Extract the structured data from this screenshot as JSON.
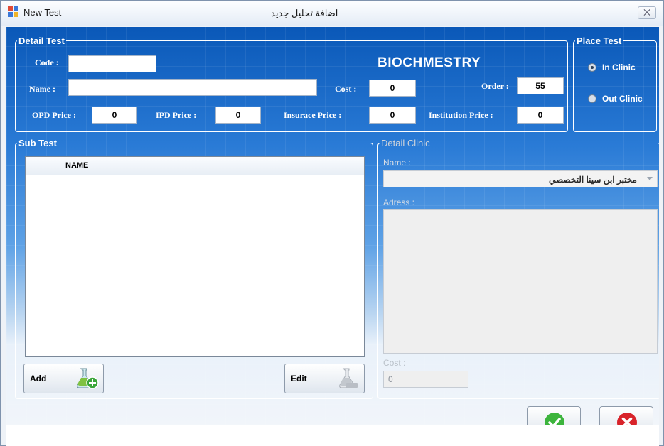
{
  "window": {
    "title": "New Test",
    "title_arabic": "اضافة تحليل جديد",
    "close_glyph": "⨉"
  },
  "detail_test": {
    "legend": "Detail Test",
    "code_label": "Code :",
    "code_value": "",
    "name_label": "Name :",
    "name_value": "",
    "department": "BIOCHMESTRY",
    "cost_label": "Cost :",
    "cost_value": "0",
    "order_label": "Order :",
    "order_value": "55",
    "opd_label": "OPD Price :",
    "opd_value": "0",
    "ipd_label": "IPD Price :",
    "ipd_value": "0",
    "insurance_label": "Insurace Price :",
    "insurance_value": "0",
    "institution_label": "Institution Price :",
    "institution_value": "0"
  },
  "place_test": {
    "legend": "Place Test",
    "options": [
      "In Clinic",
      "Out Clinic"
    ],
    "selected": "In Clinic"
  },
  "sub_test": {
    "legend": "Sub Test",
    "columns": [
      "NAME"
    ],
    "rows": [],
    "add_label": "Add",
    "edit_label": "Edit"
  },
  "detail_clinic": {
    "legend": "Detail Clinic",
    "name_label": "Name :",
    "name_value": "مختبر ابن سينا التخصصي",
    "address_label": "Adress :",
    "address_value": "",
    "cost_label": "Cost :",
    "cost_value": "0"
  },
  "actions": {
    "ok_color": "#3cb43c",
    "cancel_color": "#d8232a"
  }
}
